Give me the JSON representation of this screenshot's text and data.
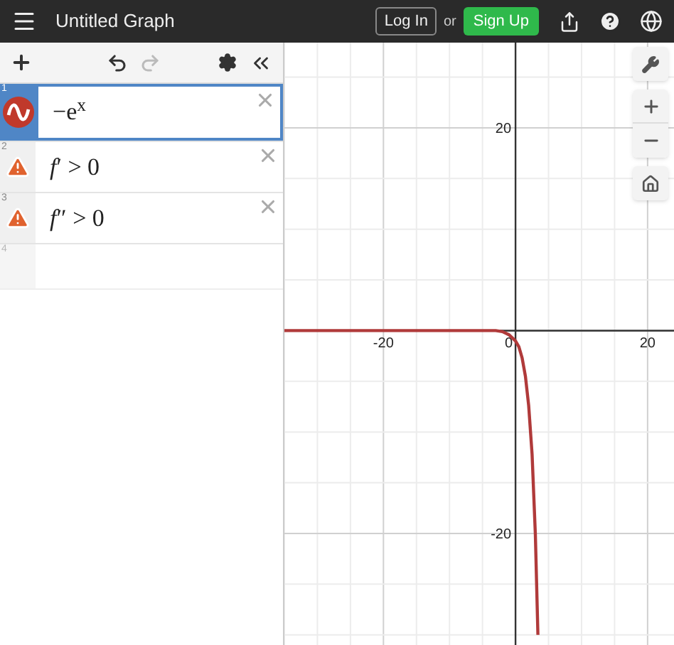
{
  "header": {
    "title": "Untitled Graph",
    "login": "Log In",
    "or": "or",
    "signup": "Sign Up"
  },
  "expressions": [
    {
      "number": "1",
      "kind": "function",
      "text": "−e$^{x}$",
      "selected": true
    },
    {
      "number": "2",
      "kind": "warning",
      "text": "*f*′ > 0",
      "selected": false
    },
    {
      "number": "3",
      "kind": "warning",
      "text": "*f*″ > 0",
      "selected": false
    },
    {
      "number": "4",
      "kind": "empty",
      "selected": false
    }
  ],
  "graph": {
    "chart_data": {
      "type": "line",
      "x": [
        -35,
        -20,
        -10,
        -5,
        -3,
        -2,
        -1,
        0,
        0.5,
        1,
        1.5,
        2,
        2.5,
        3,
        3.4
      ],
      "series": [
        {
          "color": "#b03a3a",
          "values": [
            0,
            0,
            0,
            0,
            0,
            -0.1,
            -0.4,
            -1,
            -1.6,
            -2.7,
            -4.5,
            -7.4,
            -12.2,
            -20.1,
            -30
          ]
        }
      ],
      "grid": true,
      "xlim": [
        -35,
        24
      ],
      "ylim": [
        -31,
        28.4
      ],
      "xticks": [
        -20,
        0,
        20
      ],
      "yticks": [
        -20,
        20
      ]
    }
  }
}
